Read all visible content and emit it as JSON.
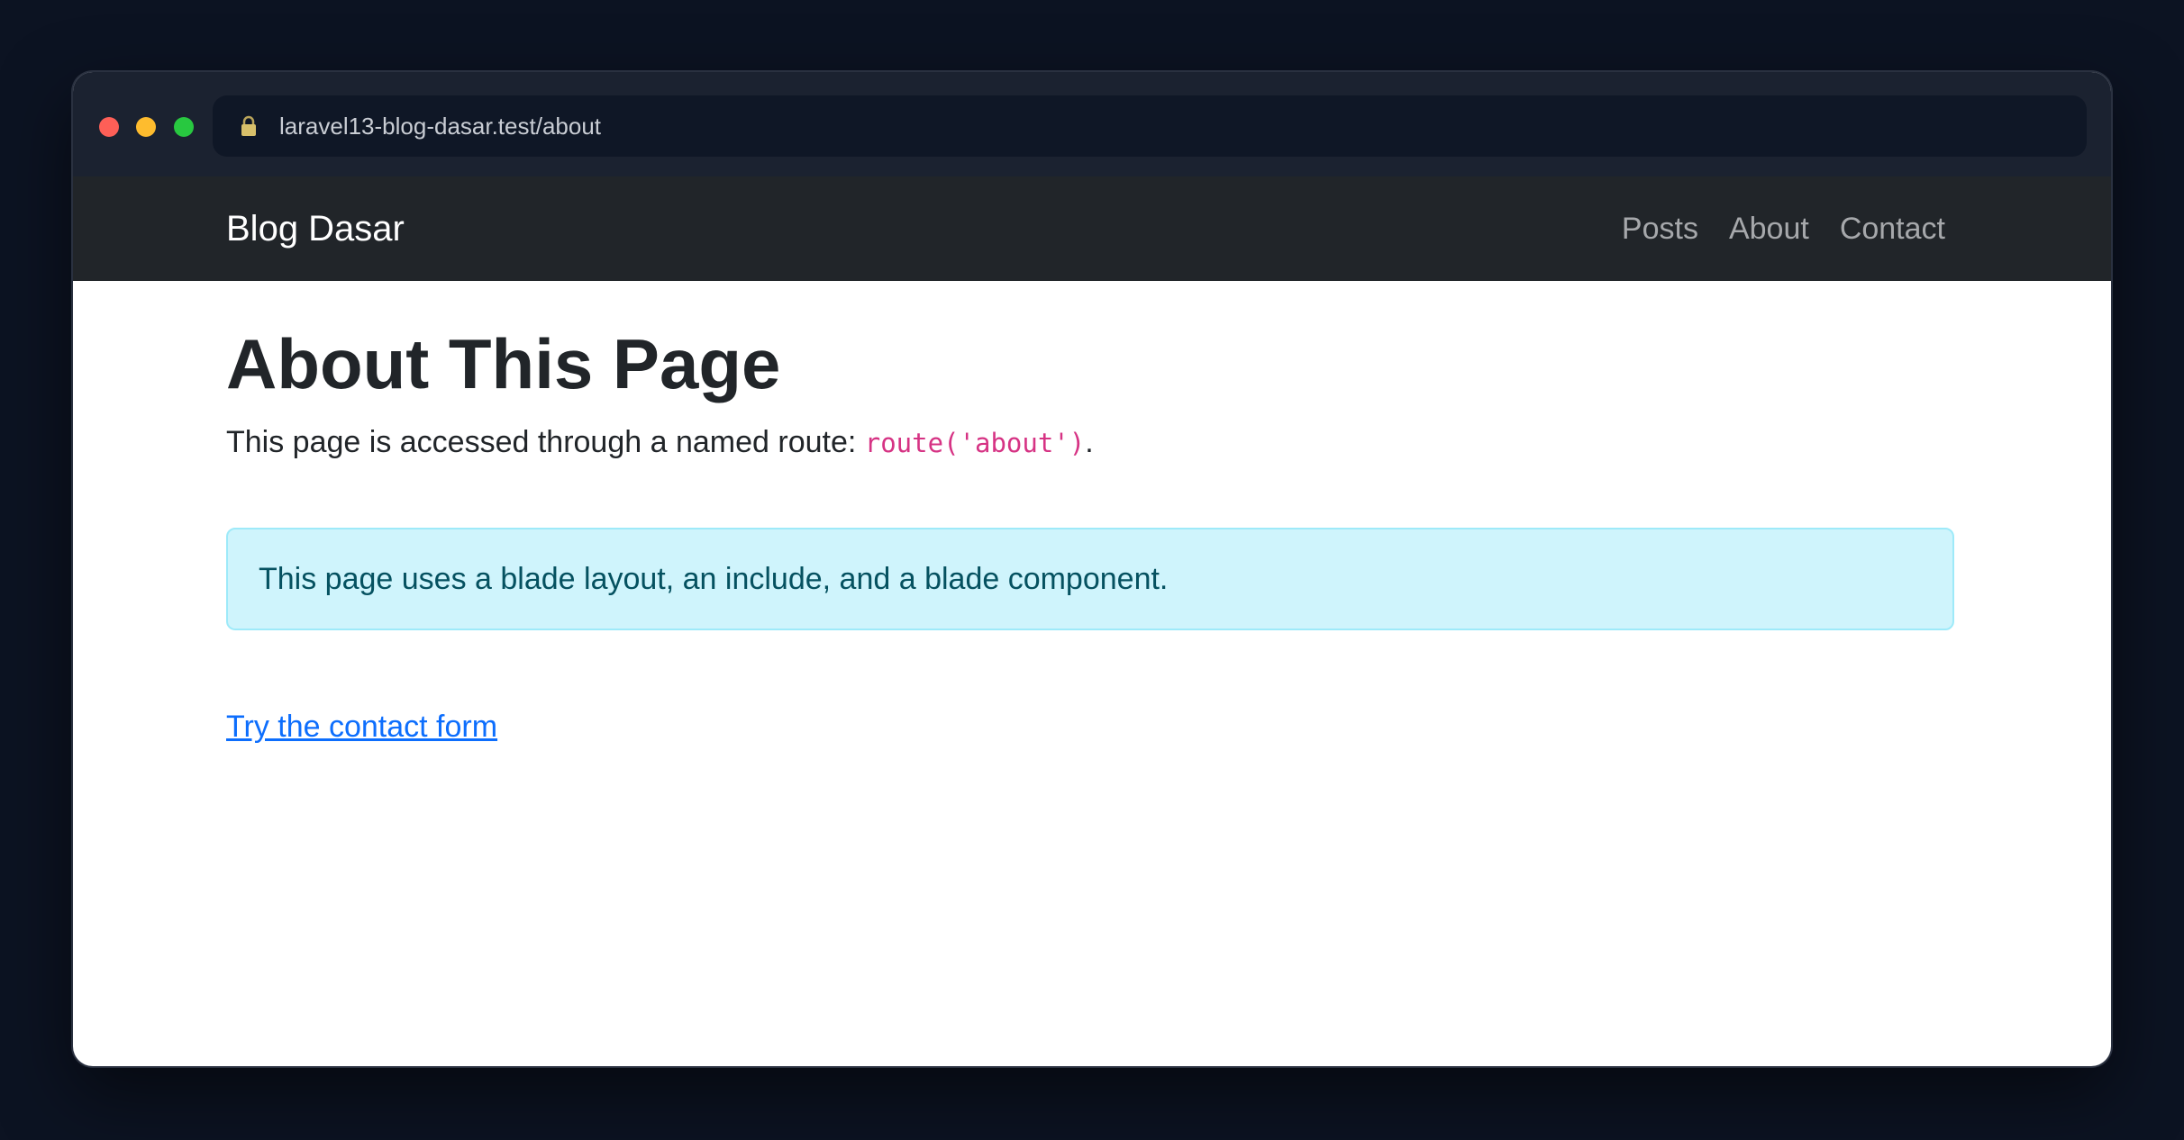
{
  "browser": {
    "url": "laravel13-blog-dasar.test/about"
  },
  "navbar": {
    "brand": "Blog Dasar",
    "links": [
      {
        "label": "Posts"
      },
      {
        "label": "About"
      },
      {
        "label": "Contact"
      }
    ]
  },
  "main": {
    "title": "About This Page",
    "lead_text": "This page is accessed through a named route: ",
    "lead_code": "route('about')",
    "lead_end": ".",
    "alert_text": "This page uses a blade layout, an include, and a blade component.",
    "link_text": "Try the contact form"
  },
  "colors": {
    "navbar_bg": "#212529",
    "alert_bg": "#cff4fc",
    "alert_text": "#055160",
    "link": "#0d6efd",
    "code": "#d63384"
  }
}
